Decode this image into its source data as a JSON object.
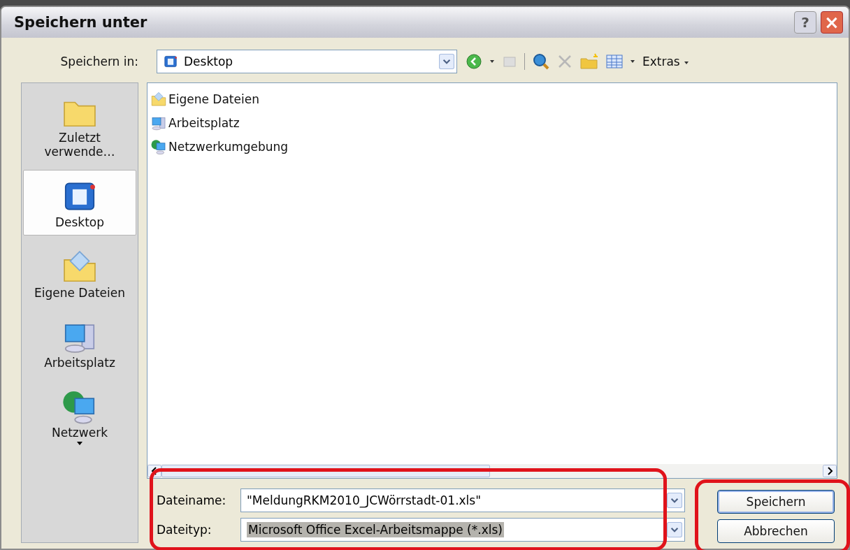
{
  "window": {
    "title": "Speichern unter",
    "help": "?",
    "close": "×"
  },
  "location": {
    "label": "Speichern in:",
    "value": "Desktop",
    "toolbar_menu": "Extras"
  },
  "places": [
    {
      "label": "Zuletzt verwende…",
      "kind": "recent",
      "selected": false
    },
    {
      "label": "Desktop",
      "kind": "desktop",
      "selected": true
    },
    {
      "label": "Eigene Dateien",
      "kind": "documents",
      "selected": false
    },
    {
      "label": "Arbeitsplatz",
      "kind": "computer",
      "selected": false
    },
    {
      "label": "Netzwerk",
      "kind": "network",
      "selected": false
    }
  ],
  "files": [
    {
      "name": "Eigene Dateien",
      "kind": "documents"
    },
    {
      "name": "Arbeitsplatz",
      "kind": "computer"
    },
    {
      "name": "Netzwerkumgebung",
      "kind": "network"
    }
  ],
  "filename": {
    "label": "Dateiname:",
    "value": "\"MeldungRKM2010_JCWörrstadt-01.xls\""
  },
  "filetype": {
    "label": "Dateityp:",
    "value": "Microsoft Office Excel-Arbeitsmappe (*.xls)"
  },
  "buttons": [
    {
      "label": "Speichern",
      "default": true
    },
    {
      "label": "Abbrechen",
      "default": false
    }
  ]
}
